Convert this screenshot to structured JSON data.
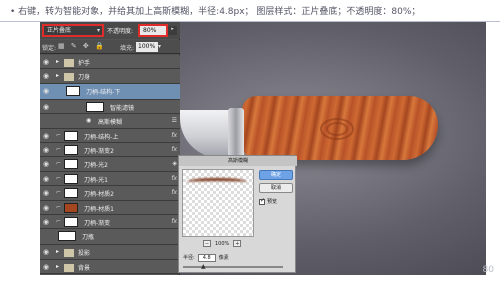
{
  "caption": "• 右键，转为智能对象，并给其加上高斯模糊，半径:4.8px；     图层样式：正片叠底；不透明度：80%；",
  "slide_number": "80",
  "panel": {
    "blend_mode": "正片叠底",
    "opacity_label": "不透明度:",
    "opacity_value": "80%",
    "lock_label": "锁定:",
    "lock_icons": "▦ ✎ ✥ 🔒",
    "fill_label": "填充:",
    "fill_value": "100%"
  },
  "layers": [
    {
      "name": "护手",
      "kind": "folder"
    },
    {
      "name": "刀身",
      "kind": "folder"
    },
    {
      "name": "刀柄-结构-下",
      "kind": "smart",
      "selected": true
    },
    {
      "name": "智能滤镜",
      "kind": "filter-mask"
    },
    {
      "name": "高斯模糊",
      "kind": "filter"
    },
    {
      "name": "刀柄-结构-上",
      "kind": "layer",
      "fx": true
    },
    {
      "name": "刀柄-渐变2",
      "kind": "layer",
      "fx": true
    },
    {
      "name": "刀柄-光2",
      "kind": "layer"
    },
    {
      "name": "刀柄-光1",
      "kind": "layer",
      "fx": true
    },
    {
      "name": "刀柄-材质2",
      "kind": "layer",
      "fx": true
    },
    {
      "name": "刀柄-材质1",
      "kind": "wood"
    },
    {
      "name": "刀柄-渐变",
      "kind": "layer",
      "fx": true
    },
    {
      "name": "刀瓶",
      "kind": "layer"
    },
    {
      "name": "投影",
      "kind": "folder"
    },
    {
      "name": "背景",
      "kind": "folder"
    }
  ],
  "dialog": {
    "title": "高斯模糊",
    "ok": "确定",
    "cancel": "取消",
    "reset": "复位",
    "preview_label": "预览",
    "zoom_out": "−",
    "zoom_value": "100%",
    "zoom_in": "+",
    "radius_label": "半径:",
    "radius_value": "4.8",
    "radius_unit": "像素"
  },
  "colors": {
    "highlight_border": "#e02b2b",
    "selected_layer": "#6f8fb3",
    "panel_bg": "#535353"
  }
}
